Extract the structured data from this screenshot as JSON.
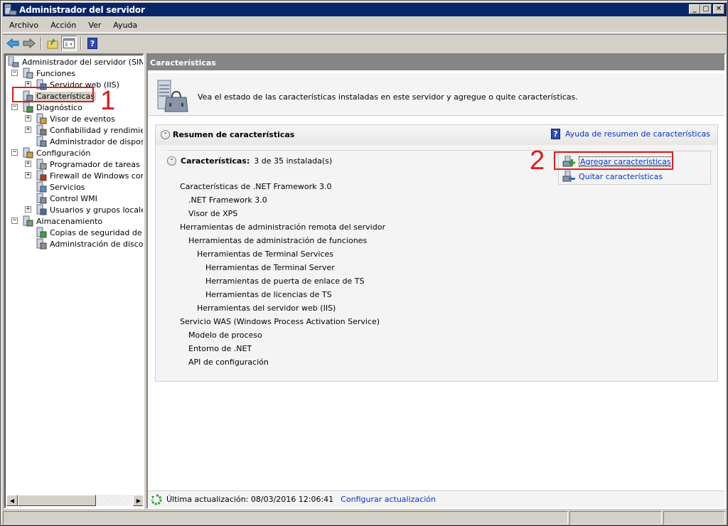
{
  "window": {
    "title": "Administrador del servidor",
    "controls": {
      "minimize": "_",
      "maximize": "□",
      "close": "✕"
    }
  },
  "menu": [
    {
      "label": "Archivo",
      "access_key": "h"
    },
    {
      "label": "Acción",
      "access_key": "A"
    },
    {
      "label": "Ver",
      "access_key": "V"
    },
    {
      "label": "Ayuda",
      "access_key": "u"
    }
  ],
  "toolbar": {
    "buttons": [
      "back-icon",
      "forward-icon",
      "up-folder-icon",
      "show-hide-console-tree-icon",
      "help-icon"
    ]
  },
  "tree": {
    "root": "Administrador del servidor (SINTES",
    "items": [
      {
        "label": "Funciones",
        "level": 1,
        "expander": "−",
        "icon": "roles-icon"
      },
      {
        "label": "Servidor web (IIS)",
        "level": 2,
        "expander": "+",
        "icon": "iis-icon"
      },
      {
        "label": "Características",
        "level": 1,
        "expander": "",
        "icon": "features-icon",
        "selected": true
      },
      {
        "label": "Diagnóstico",
        "level": 1,
        "expander": "−",
        "icon": "diagnostics-icon"
      },
      {
        "label": "Visor de eventos",
        "level": 2,
        "expander": "+",
        "icon": "event-viewer-icon"
      },
      {
        "label": "Confiabilidad y rendimiento",
        "level": 2,
        "expander": "+",
        "icon": "reliability-icon"
      },
      {
        "label": "Administrador de dispositivo",
        "level": 2,
        "expander": "",
        "icon": "device-manager-icon"
      },
      {
        "label": "Configuración",
        "level": 1,
        "expander": "−",
        "icon": "configuration-icon"
      },
      {
        "label": "Programador de tareas",
        "level": 2,
        "expander": "+",
        "icon": "task-scheduler-icon"
      },
      {
        "label": "Firewall de Windows con se",
        "level": 2,
        "expander": "+",
        "icon": "firewall-icon"
      },
      {
        "label": "Servicios",
        "level": 2,
        "expander": "",
        "icon": "services-icon"
      },
      {
        "label": "Control WMI",
        "level": 2,
        "expander": "",
        "icon": "wmi-icon"
      },
      {
        "label": "Usuarios y grupos locales",
        "level": 2,
        "expander": "+",
        "icon": "users-groups-icon"
      },
      {
        "label": "Almacenamiento",
        "level": 1,
        "expander": "−",
        "icon": "storage-icon"
      },
      {
        "label": "Copias de seguridad de Wir",
        "level": 2,
        "expander": "",
        "icon": "backup-icon"
      },
      {
        "label": "Administración de discos",
        "level": 2,
        "expander": "",
        "icon": "disk-management-icon"
      }
    ]
  },
  "main": {
    "header": "Características",
    "description": "Vea el estado de las características instaladas en este servidor y agregue o quite características.",
    "summary": {
      "title": "Resumen de características",
      "help_link": "Ayuda de resumen de características",
      "sub_title": "Características:",
      "count": "3 de 35 instalada(s)",
      "features": [
        {
          "label": "Características de .NET Framework 3.0",
          "level": 0
        },
        {
          "label": ".NET Framework 3.0",
          "level": 1
        },
        {
          "label": "Visor de XPS",
          "level": 1
        },
        {
          "label": "Herramientas de administración remota del servidor",
          "level": 0
        },
        {
          "label": "Herramientas de administración de funciones",
          "level": 1
        },
        {
          "label": "Herramientas de Terminal Services",
          "level": 2
        },
        {
          "label": "Herramientas de Terminal Server",
          "level": 3
        },
        {
          "label": "Herramientas de puerta de enlace de TS",
          "level": 3
        },
        {
          "label": "Herramientas de licencias de TS",
          "level": 3
        },
        {
          "label": "Herramientas del servidor web (IIS)",
          "level": 2
        },
        {
          "label": "Servicio WAS (Windows Process Activation Service)",
          "level": 0
        },
        {
          "label": "Modelo de proceso",
          "level": 1
        },
        {
          "label": "Entorno de .NET",
          "level": 1
        },
        {
          "label": "API de configuración",
          "level": 1
        }
      ],
      "actions": {
        "add": "Agregar características",
        "remove": "Quitar características"
      }
    },
    "status": {
      "last_update": "Última actualización: 08/03/2016 12:06:41",
      "configure_link": "Configurar actualización"
    }
  },
  "annotations": {
    "step1": "1",
    "step2": "2",
    "color": "#e31b1b"
  },
  "colors": {
    "titlebar": "#0a246a",
    "link": "#0033cc",
    "pane_header": "#858585"
  }
}
